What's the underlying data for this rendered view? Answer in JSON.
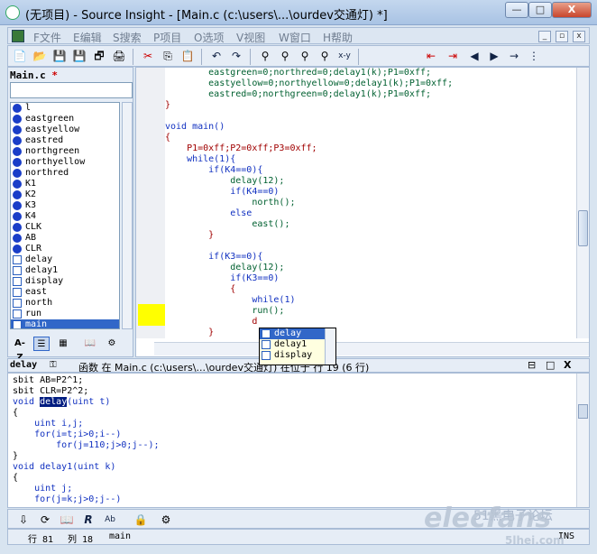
{
  "title": "(无项目) - Source Insight - [Main.c (c:\\users\\...\\ourdev交通灯) *]",
  "window_controls": {
    "minimize": "—",
    "maximize": "□",
    "close": "X"
  },
  "menu": [
    "F文件",
    "E编辑",
    "S搜索",
    "P项目",
    "O选项",
    "V视图",
    "W窗口",
    "H帮助"
  ],
  "mdi_controls": {
    "minimize": "_",
    "restore": "▫",
    "close": "x"
  },
  "toolbar_icons": [
    "new-file-icon",
    "open-folder-icon",
    "save-icon",
    "save-all-icon",
    "close-file-icon",
    "print-icon",
    "cut-icon",
    "copy-icon",
    "paste-icon",
    "undo-icon",
    "redo-icon",
    "binoculars-icon",
    "find-prev-icon",
    "find-next-icon",
    "replace-icon",
    "cross-ref-icon",
    "bookmark-prev-icon",
    "bookmark-next-icon",
    "back-arrow-icon",
    "forward-arrow-icon",
    "jump-to-icon",
    "more-icon"
  ],
  "left_panel": {
    "file_label": "Main.c",
    "modified_marker": "*",
    "symbols": [
      {
        "name": "l",
        "kind": "oval"
      },
      {
        "name": "eastgreen",
        "kind": "oval"
      },
      {
        "name": "eastyellow",
        "kind": "oval"
      },
      {
        "name": "eastred",
        "kind": "oval"
      },
      {
        "name": "northgreen",
        "kind": "oval"
      },
      {
        "name": "northyellow",
        "kind": "oval"
      },
      {
        "name": "northred",
        "kind": "oval"
      },
      {
        "name": "K1",
        "kind": "oval"
      },
      {
        "name": "K2",
        "kind": "oval"
      },
      {
        "name": "K3",
        "kind": "oval"
      },
      {
        "name": "K4",
        "kind": "oval"
      },
      {
        "name": "CLK",
        "kind": "oval"
      },
      {
        "name": "AB",
        "kind": "oval"
      },
      {
        "name": "CLR",
        "kind": "oval"
      },
      {
        "name": "delay",
        "kind": "func"
      },
      {
        "name": "delay1",
        "kind": "func"
      },
      {
        "name": "display",
        "kind": "func"
      },
      {
        "name": "east",
        "kind": "func"
      },
      {
        "name": "north",
        "kind": "func"
      },
      {
        "name": "run",
        "kind": "func"
      },
      {
        "name": "main",
        "kind": "func",
        "selected": true
      }
    ],
    "bottom_buttons": [
      "A-Z",
      "list-view-icon",
      "category-view-icon",
      "book-icon",
      "settings-icon"
    ]
  },
  "editor": {
    "lines": [
      "        eastgreen=0;northred=0;delay1(k);P1=0xff;",
      "        eastyellow=0;northyellow=0;delay1(k);P1=0xff;",
      "        eastred=0;northgreen=0;delay1(k);P1=0xff;",
      "}",
      "",
      "void main()",
      "{",
      "    P1=0xff;P2=0xff;P3=0xff;",
      "    while(1){",
      "        if(K4==0){",
      "            delay(12);",
      "            if(K4==0)",
      "                north();",
      "            else",
      "                east();",
      "        }",
      "",
      "        if(K3==0){",
      "            delay(12);",
      "            if(K3==0)",
      "            {",
      "                while(1)",
      "                run();",
      "                d",
      "        }"
    ]
  },
  "autocomplete": [
    "delay",
    "delay1",
    "display"
  ],
  "context": {
    "symbol": "delay",
    "info": "函数 在 Main.c (c:\\users\\...\\ourdev交通灯) 在位于 行 19 (6 行)",
    "lines": [
      "sbit AB=P2^1;",
      "sbit CLR=P2^2;",
      "void delay(uint t)",
      "{",
      "    uint i,j;",
      "    for(i=t;i>0;i--)",
      "        for(j=110;j>0;j--);",
      "}",
      "void delay1(uint k)",
      "{",
      "    uint j;",
      "    for(j=k;j>0;j--)"
    ],
    "panel_controls": {
      "restore": "⊟",
      "maximize": "□",
      "close": "X"
    }
  },
  "status": {
    "line": "行 81",
    "col": "列 18",
    "func": "main",
    "mode": "INS"
  },
  "watermark": {
    "main": "elecfans",
    "sub": "51黑电子论坛",
    "sub2": "5lhei.com"
  }
}
